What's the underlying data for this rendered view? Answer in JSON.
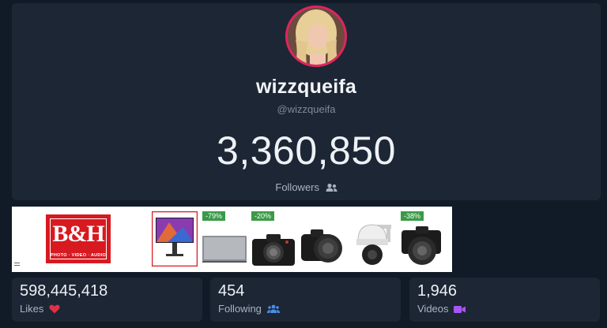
{
  "profile": {
    "username": "wizzqueifa",
    "handle": "@wizzqueifa",
    "followers_count": "3,360,850",
    "followers_label": "Followers",
    "avatar_ring_color": "#e0245e"
  },
  "ad": {
    "brand_logo_text": "B&H",
    "brand_logo_subtext": "PHOTO · VIDEO · AUDIO",
    "brand_color": "#d71920",
    "discounts": [
      "-79%",
      "-20%",
      "-38%"
    ],
    "products": [
      "monitor",
      "mirrorless-camera-body",
      "bridge-camera",
      "ptz-camera",
      "mirrorless-camera-with-lens"
    ]
  },
  "stats": {
    "likes": {
      "value": "598,445,418",
      "label": "Likes",
      "icon": "heart-icon"
    },
    "following": {
      "value": "454",
      "label": "Following",
      "icon": "users-icon"
    },
    "videos": {
      "value": "1,946",
      "label": "Videos",
      "icon": "video-camera-icon"
    }
  }
}
